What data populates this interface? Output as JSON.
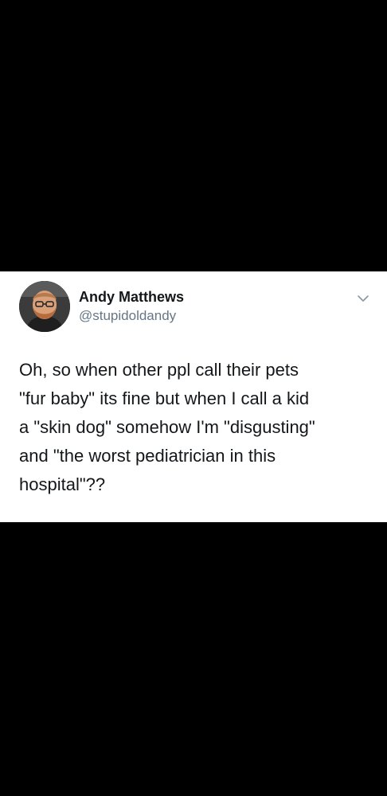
{
  "tweet": {
    "author_name": "Andy Matthews",
    "author_handle": "@stupidoldandy",
    "text_lines": [
      "Oh, so when other ppl call their pets",
      "\"fur baby\" its fine but when I call a kid",
      "a \"skin dog\" somehow I'm \"disgusting\"",
      "and \"the worst pediatrician in this",
      "hospital\"??"
    ],
    "menu_icon": "chevron-down-icon",
    "avatar_icon": "profile-photo"
  },
  "colors": {
    "background": "#000000",
    "card": "#ffffff",
    "text_primary": "#14171a",
    "text_secondary": "#657786"
  }
}
